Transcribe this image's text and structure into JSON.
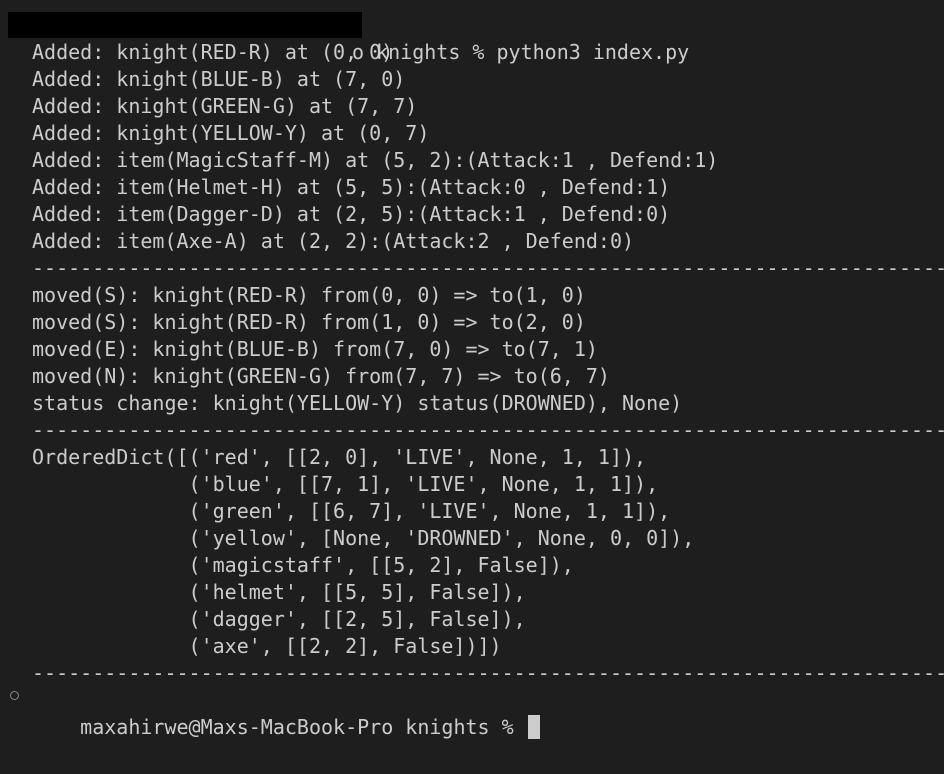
{
  "terminal": {
    "command_line": "o knights % python3 index.py",
    "lines": [
      "Added: knight(RED-R) at (0, 0)",
      "Added: knight(BLUE-B) at (7, 0)",
      "Added: knight(GREEN-G) at (7, 7)",
      "Added: knight(YELLOW-Y) at (0, 7)",
      "Added: item(MagicStaff-M) at (5, 2):(Attack:1 , Defend:1)",
      "Added: item(Helmet-H) at (5, 5):(Attack:0 , Defend:1)",
      "Added: item(Dagger-D) at (2, 5):(Attack:1 , Defend:0)",
      "Added: item(Axe-A) at (2, 2):(Attack:2 , Defend:0)",
      "--------------------------------------------------------------------------------------------",
      "moved(S): knight(RED-R) from(0, 0) => to(1, 0)",
      "moved(S): knight(RED-R) from(1, 0) => to(2, 0)",
      "moved(E): knight(BLUE-B) from(7, 0) => to(7, 1)",
      "moved(N): knight(GREEN-G) from(7, 7) => to(6, 7)",
      "status change: knight(YELLOW-Y) status(DROWNED), None)",
      "--------------------------------------------------------------------------------------------",
      "OrderedDict([('red', [[2, 0], 'LIVE', None, 1, 1]),",
      "             ('blue', [[7, 1], 'LIVE', None, 1, 1]),",
      "             ('green', [[6, 7], 'LIVE', None, 1, 1]),",
      "             ('yellow', [None, 'DROWNED', None, 0, 0]),",
      "             ('magicstaff', [[5, 2], False]),",
      "             ('helmet', [[5, 5], False]),",
      "             ('dagger', [[2, 5], False]),",
      "             ('axe', [[2, 2], False])])",
      "--------------------------------------------------------------------------------------------"
    ],
    "prompt": "maxahirwe@Maxs-MacBook-Pro knights % "
  },
  "colors": {
    "background": "#1e1e1e",
    "text": "#cccccc",
    "redaction": "#000000"
  }
}
